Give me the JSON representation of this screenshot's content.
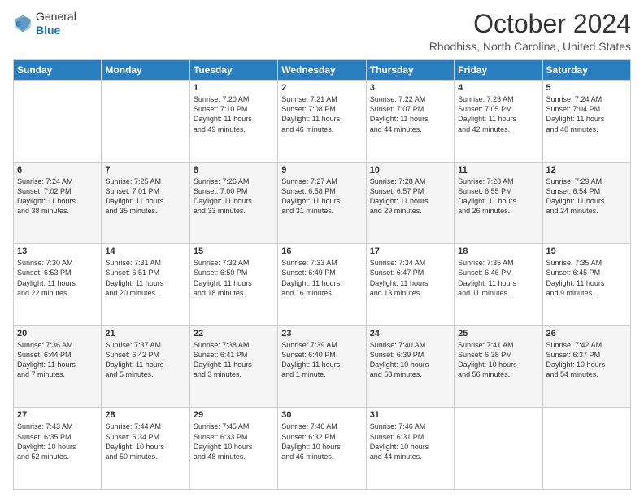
{
  "logo": {
    "general": "General",
    "blue": "Blue"
  },
  "header": {
    "month": "October 2024",
    "location": "Rhodhiss, North Carolina, United States"
  },
  "days_of_week": [
    "Sunday",
    "Monday",
    "Tuesday",
    "Wednesday",
    "Thursday",
    "Friday",
    "Saturday"
  ],
  "weeks": [
    [
      {
        "num": "",
        "content": ""
      },
      {
        "num": "",
        "content": ""
      },
      {
        "num": "1",
        "content": "Sunrise: 7:20 AM\nSunset: 7:10 PM\nDaylight: 11 hours\nand 49 minutes."
      },
      {
        "num": "2",
        "content": "Sunrise: 7:21 AM\nSunset: 7:08 PM\nDaylight: 11 hours\nand 46 minutes."
      },
      {
        "num": "3",
        "content": "Sunrise: 7:22 AM\nSunset: 7:07 PM\nDaylight: 11 hours\nand 44 minutes."
      },
      {
        "num": "4",
        "content": "Sunrise: 7:23 AM\nSunset: 7:05 PM\nDaylight: 11 hours\nand 42 minutes."
      },
      {
        "num": "5",
        "content": "Sunrise: 7:24 AM\nSunset: 7:04 PM\nDaylight: 11 hours\nand 40 minutes."
      }
    ],
    [
      {
        "num": "6",
        "content": "Sunrise: 7:24 AM\nSunset: 7:02 PM\nDaylight: 11 hours\nand 38 minutes."
      },
      {
        "num": "7",
        "content": "Sunrise: 7:25 AM\nSunset: 7:01 PM\nDaylight: 11 hours\nand 35 minutes."
      },
      {
        "num": "8",
        "content": "Sunrise: 7:26 AM\nSunset: 7:00 PM\nDaylight: 11 hours\nand 33 minutes."
      },
      {
        "num": "9",
        "content": "Sunrise: 7:27 AM\nSunset: 6:58 PM\nDaylight: 11 hours\nand 31 minutes."
      },
      {
        "num": "10",
        "content": "Sunrise: 7:28 AM\nSunset: 6:57 PM\nDaylight: 11 hours\nand 29 minutes."
      },
      {
        "num": "11",
        "content": "Sunrise: 7:28 AM\nSunset: 6:55 PM\nDaylight: 11 hours\nand 26 minutes."
      },
      {
        "num": "12",
        "content": "Sunrise: 7:29 AM\nSunset: 6:54 PM\nDaylight: 11 hours\nand 24 minutes."
      }
    ],
    [
      {
        "num": "13",
        "content": "Sunrise: 7:30 AM\nSunset: 6:53 PM\nDaylight: 11 hours\nand 22 minutes."
      },
      {
        "num": "14",
        "content": "Sunrise: 7:31 AM\nSunset: 6:51 PM\nDaylight: 11 hours\nand 20 minutes."
      },
      {
        "num": "15",
        "content": "Sunrise: 7:32 AM\nSunset: 6:50 PM\nDaylight: 11 hours\nand 18 minutes."
      },
      {
        "num": "16",
        "content": "Sunrise: 7:33 AM\nSunset: 6:49 PM\nDaylight: 11 hours\nand 16 minutes."
      },
      {
        "num": "17",
        "content": "Sunrise: 7:34 AM\nSunset: 6:47 PM\nDaylight: 11 hours\nand 13 minutes."
      },
      {
        "num": "18",
        "content": "Sunrise: 7:35 AM\nSunset: 6:46 PM\nDaylight: 11 hours\nand 11 minutes."
      },
      {
        "num": "19",
        "content": "Sunrise: 7:35 AM\nSunset: 6:45 PM\nDaylight: 11 hours\nand 9 minutes."
      }
    ],
    [
      {
        "num": "20",
        "content": "Sunrise: 7:36 AM\nSunset: 6:44 PM\nDaylight: 11 hours\nand 7 minutes."
      },
      {
        "num": "21",
        "content": "Sunrise: 7:37 AM\nSunset: 6:42 PM\nDaylight: 11 hours\nand 5 minutes."
      },
      {
        "num": "22",
        "content": "Sunrise: 7:38 AM\nSunset: 6:41 PM\nDaylight: 11 hours\nand 3 minutes."
      },
      {
        "num": "23",
        "content": "Sunrise: 7:39 AM\nSunset: 6:40 PM\nDaylight: 11 hours\nand 1 minute."
      },
      {
        "num": "24",
        "content": "Sunrise: 7:40 AM\nSunset: 6:39 PM\nDaylight: 10 hours\nand 58 minutes."
      },
      {
        "num": "25",
        "content": "Sunrise: 7:41 AM\nSunset: 6:38 PM\nDaylight: 10 hours\nand 56 minutes."
      },
      {
        "num": "26",
        "content": "Sunrise: 7:42 AM\nSunset: 6:37 PM\nDaylight: 10 hours\nand 54 minutes."
      }
    ],
    [
      {
        "num": "27",
        "content": "Sunrise: 7:43 AM\nSunset: 6:35 PM\nDaylight: 10 hours\nand 52 minutes."
      },
      {
        "num": "28",
        "content": "Sunrise: 7:44 AM\nSunset: 6:34 PM\nDaylight: 10 hours\nand 50 minutes."
      },
      {
        "num": "29",
        "content": "Sunrise: 7:45 AM\nSunset: 6:33 PM\nDaylight: 10 hours\nand 48 minutes."
      },
      {
        "num": "30",
        "content": "Sunrise: 7:46 AM\nSunset: 6:32 PM\nDaylight: 10 hours\nand 46 minutes."
      },
      {
        "num": "31",
        "content": "Sunrise: 7:46 AM\nSunset: 6:31 PM\nDaylight: 10 hours\nand 44 minutes."
      },
      {
        "num": "",
        "content": ""
      },
      {
        "num": "",
        "content": ""
      }
    ]
  ]
}
